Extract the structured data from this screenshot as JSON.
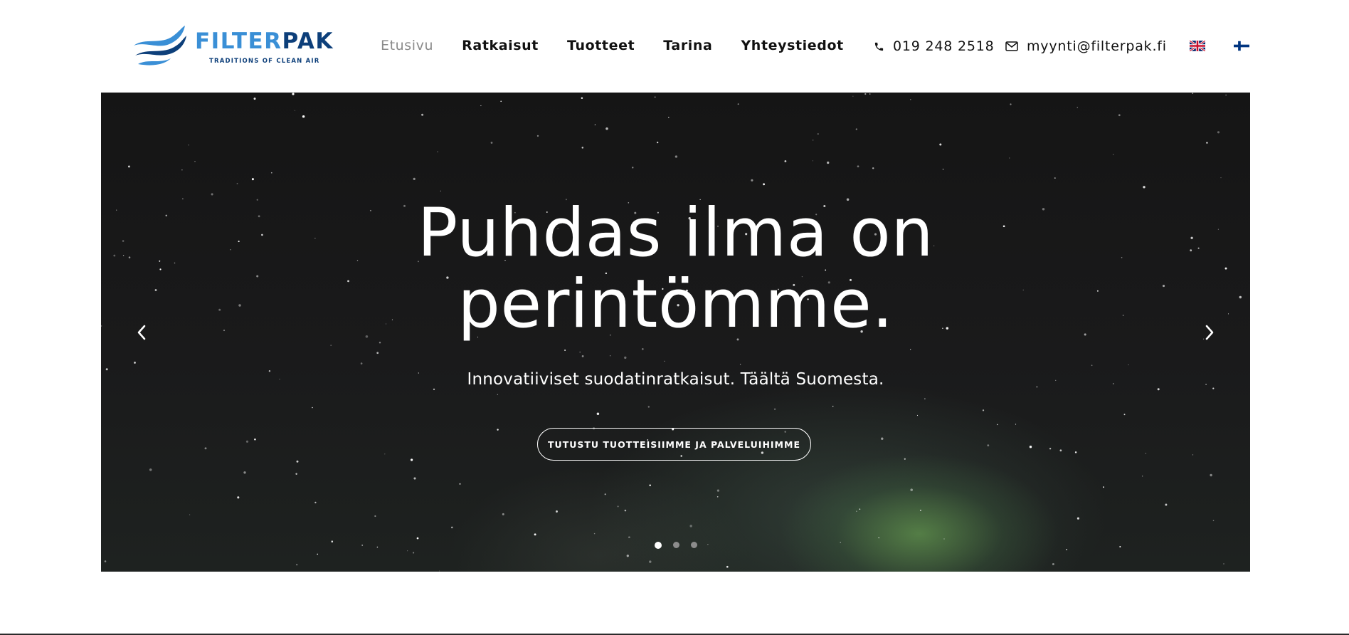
{
  "brand": {
    "name_part1": "FILTER",
    "name_part2": "PAK",
    "tagline": "TRADITIONS OF CLEAN AIR",
    "colors": {
      "light_blue": "#3a8fd6",
      "dark_blue": "#0d3f7a"
    }
  },
  "nav": {
    "items": [
      {
        "label": "Etusivu",
        "active": true
      },
      {
        "label": "Ratkaisut",
        "active": false
      },
      {
        "label": "Tuotteet",
        "active": false
      },
      {
        "label": "Tarina",
        "active": false
      },
      {
        "label": "Yhteystiedot",
        "active": false
      }
    ]
  },
  "contact": {
    "phone_icon": "phone-icon",
    "phone": "019 248 2518",
    "email_icon": "envelope-icon",
    "email": "myynti@filterpak.fi"
  },
  "languages": [
    {
      "icon": "uk-flag-icon",
      "code": "en"
    },
    {
      "icon": "finland-flag-icon",
      "code": "fi"
    }
  ],
  "hero": {
    "title_line1": "Puhdas ilma on",
    "title_line2": "perintömme.",
    "subtitle": "Innovatiiviset suodatinratkaisut. Täältä Suomesta.",
    "button_label": "TUTUSTU TUOTTEISIIMME JA PALVELUIHIMME",
    "prev_icon": "chevron-left-icon",
    "next_icon": "chevron-right-icon",
    "slides_total": 3,
    "active_slide": 1
  }
}
